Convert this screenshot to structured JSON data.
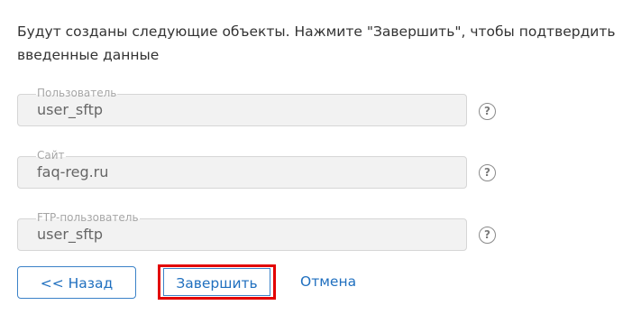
{
  "intro": {
    "text": "Будут созданы следующие объекты. Нажмите \"Завершить\", чтобы подтвердить введенные данные"
  },
  "fields": [
    {
      "label": "Пользователь",
      "value": "user_sftp",
      "help_icon": "question-circle-icon",
      "help_glyph": "?"
    },
    {
      "label": "Сайт",
      "value": "faq-reg.ru",
      "help_icon": "question-circle-icon",
      "help_glyph": "?"
    },
    {
      "label": "FTP-пользователь",
      "value": "user_sftp",
      "help_icon": "question-circle-icon",
      "help_glyph": "?"
    }
  ],
  "actions": {
    "back_label": "<< Назад",
    "finish_label": "Завершить",
    "cancel_label": "Отмена"
  },
  "colors": {
    "accent": "#1f6fbf",
    "highlight_outline": "#e30000",
    "field_background": "#f2f2f2"
  }
}
